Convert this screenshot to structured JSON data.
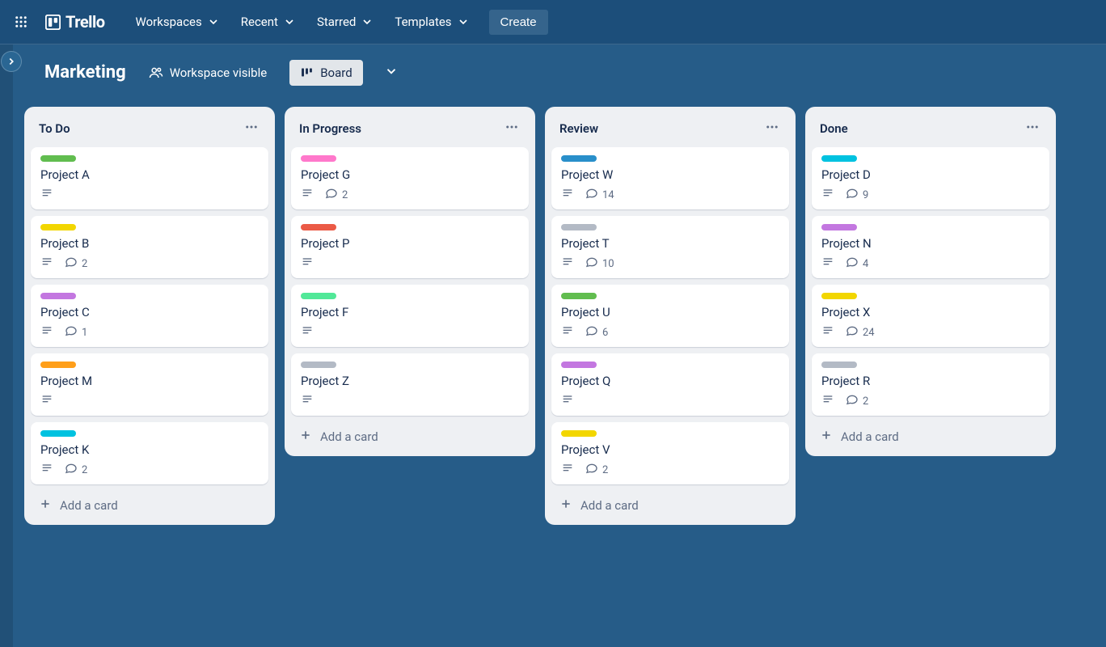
{
  "nav": {
    "logo_text": "Trello",
    "items": [
      "Workspaces",
      "Recent",
      "Starred",
      "Templates"
    ],
    "create_label": "Create"
  },
  "board": {
    "title": "Marketing",
    "visibility_label": "Workspace visible",
    "view_label": "Board",
    "add_card_label": "Add a card"
  },
  "lists": [
    {
      "title": "To Do",
      "cards": [
        {
          "title": "Project A",
          "label_color": "c-green",
          "has_desc": true,
          "comments": null
        },
        {
          "title": "Project B",
          "label_color": "c-yellow",
          "has_desc": true,
          "comments": 2
        },
        {
          "title": "Project C",
          "label_color": "c-purple",
          "has_desc": true,
          "comments": 1
        },
        {
          "title": "Project M",
          "label_color": "c-orange",
          "has_desc": true,
          "comments": null
        },
        {
          "title": "Project K",
          "label_color": "c-cyan",
          "has_desc": true,
          "comments": 2
        }
      ]
    },
    {
      "title": "In Progress",
      "cards": [
        {
          "title": "Project G",
          "label_color": "c-pink",
          "has_desc": true,
          "comments": 2
        },
        {
          "title": "Project P",
          "label_color": "c-red",
          "has_desc": true,
          "comments": null
        },
        {
          "title": "Project F",
          "label_color": "c-mint",
          "has_desc": true,
          "comments": null
        },
        {
          "title": "Project Z",
          "label_color": "c-gray",
          "has_desc": true,
          "comments": null
        }
      ]
    },
    {
      "title": "Review",
      "cards": [
        {
          "title": "Project W",
          "label_color": "c-blue",
          "has_desc": true,
          "comments": 14
        },
        {
          "title": "Project T",
          "label_color": "c-gray",
          "has_desc": true,
          "comments": 10
        },
        {
          "title": "Project U",
          "label_color": "c-green",
          "has_desc": true,
          "comments": 6
        },
        {
          "title": "Project Q",
          "label_color": "c-purple",
          "has_desc": true,
          "comments": null
        },
        {
          "title": "Project V",
          "label_color": "c-yellow",
          "has_desc": true,
          "comments": 2
        }
      ]
    },
    {
      "title": "Done",
      "cards": [
        {
          "title": "Project D",
          "label_color": "c-cyan",
          "has_desc": true,
          "comments": 9
        },
        {
          "title": "Project N",
          "label_color": "c-purple",
          "has_desc": true,
          "comments": 4
        },
        {
          "title": "Project X",
          "label_color": "c-yellow",
          "has_desc": true,
          "comments": 24
        },
        {
          "title": "Project R",
          "label_color": "c-gray",
          "has_desc": true,
          "comments": 2
        }
      ]
    }
  ]
}
